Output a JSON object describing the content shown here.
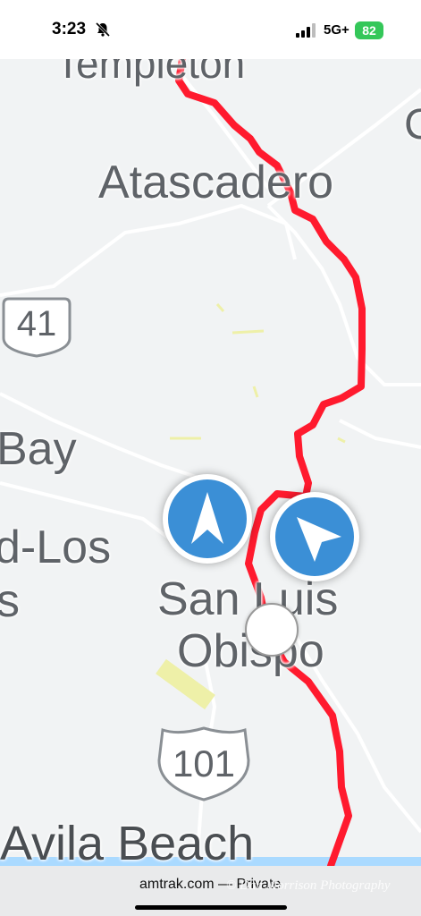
{
  "status_bar": {
    "time": "3:23",
    "network": "5G+",
    "battery": "82"
  },
  "map": {
    "places": {
      "templeton": "Templeton",
      "atascadero": "Atascadero",
      "bay": "Bay",
      "los_osos_part1": "d-Los",
      "los_osos_part2": "s",
      "san_luis": "San Luis",
      "obispo": "Obispo",
      "avila_beach": "Avila Beach",
      "edge_letter": "C"
    },
    "highways": {
      "ca_41": "41",
      "us_101": "101"
    },
    "colors": {
      "route": "#ff1a2e",
      "marker": "#3b8fd6",
      "land": "#f1f3f4",
      "road": "#ffffff",
      "label": "#5f6368"
    },
    "markers": [
      {
        "name": "train-marker-north",
        "icon": "navigation-arrow-north-icon"
      },
      {
        "name": "train-marker-northwest",
        "icon": "navigation-arrow-northwest-icon"
      }
    ]
  },
  "browser": {
    "url": "amtrak.com — Private",
    "watermark": "© Dan Morrison Photography"
  }
}
